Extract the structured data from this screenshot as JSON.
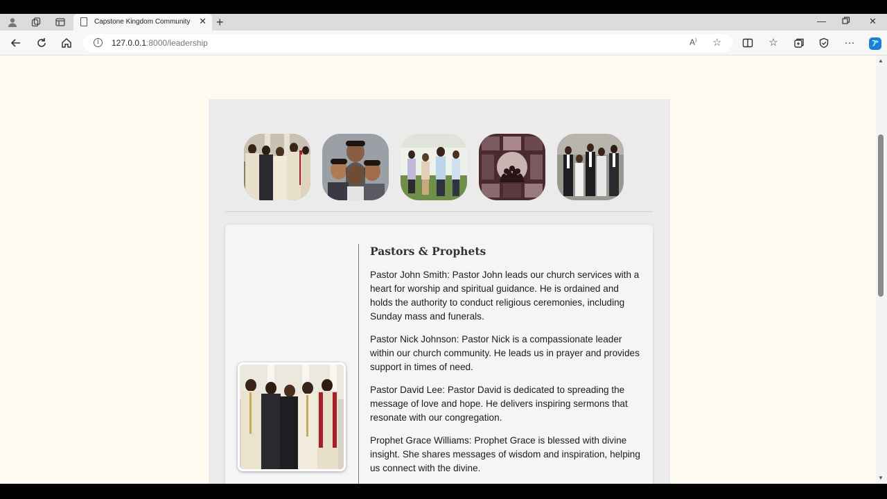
{
  "browser": {
    "tab_title": "Capstone Kingdom Community",
    "url_host": "127.0.0.1",
    "url_path": ":8000/leadership",
    "icons": [
      "profile-icon",
      "workspaces-icon",
      "tab-actions-icon",
      "page-icon",
      "close-icon",
      "new-tab-icon",
      "minimize-icon",
      "restore-icon",
      "close-window-icon",
      "back-icon",
      "refresh-icon",
      "home-icon",
      "info-icon",
      "read-aloud-icon",
      "favorite-icon",
      "split-screen-icon",
      "favorites-icon",
      "collections-icon",
      "extensions-icon",
      "more-icon",
      "copilot-icon"
    ]
  },
  "leadership": {
    "thumbnails": [
      {
        "name": "pastors-group"
      },
      {
        "name": "youth-group"
      },
      {
        "name": "ministry-team"
      },
      {
        "name": "worship-collage"
      },
      {
        "name": "deacons-group"
      }
    ],
    "section_title": "Pastors & Prophets",
    "bios": [
      "Pastor John Smith: Pastor John leads our church services with a heart for worship and spiritual guidance. He is ordained and holds the authority to conduct religious ceremonies, including Sunday mass and funerals.",
      "Pastor Nick Johnson: Pastor Nick is a compassionate leader within our church community. He leads us in prayer and provides support in times of need.",
      "Pastor David Lee: Pastor David is dedicated to spreading the message of love and hope. He delivers inspiring sermons that resonate with our congregation.",
      "Prophet Grace Williams: Prophet Grace is blessed with divine insight. She shares messages of wisdom and inspiration, helping us connect with the divine."
    ]
  },
  "colors": {
    "page_background": "#fefaef",
    "panel_background": "#ebebeb",
    "card_background": "#f5f5f5",
    "copilot_accent": "#1a7fd9"
  }
}
